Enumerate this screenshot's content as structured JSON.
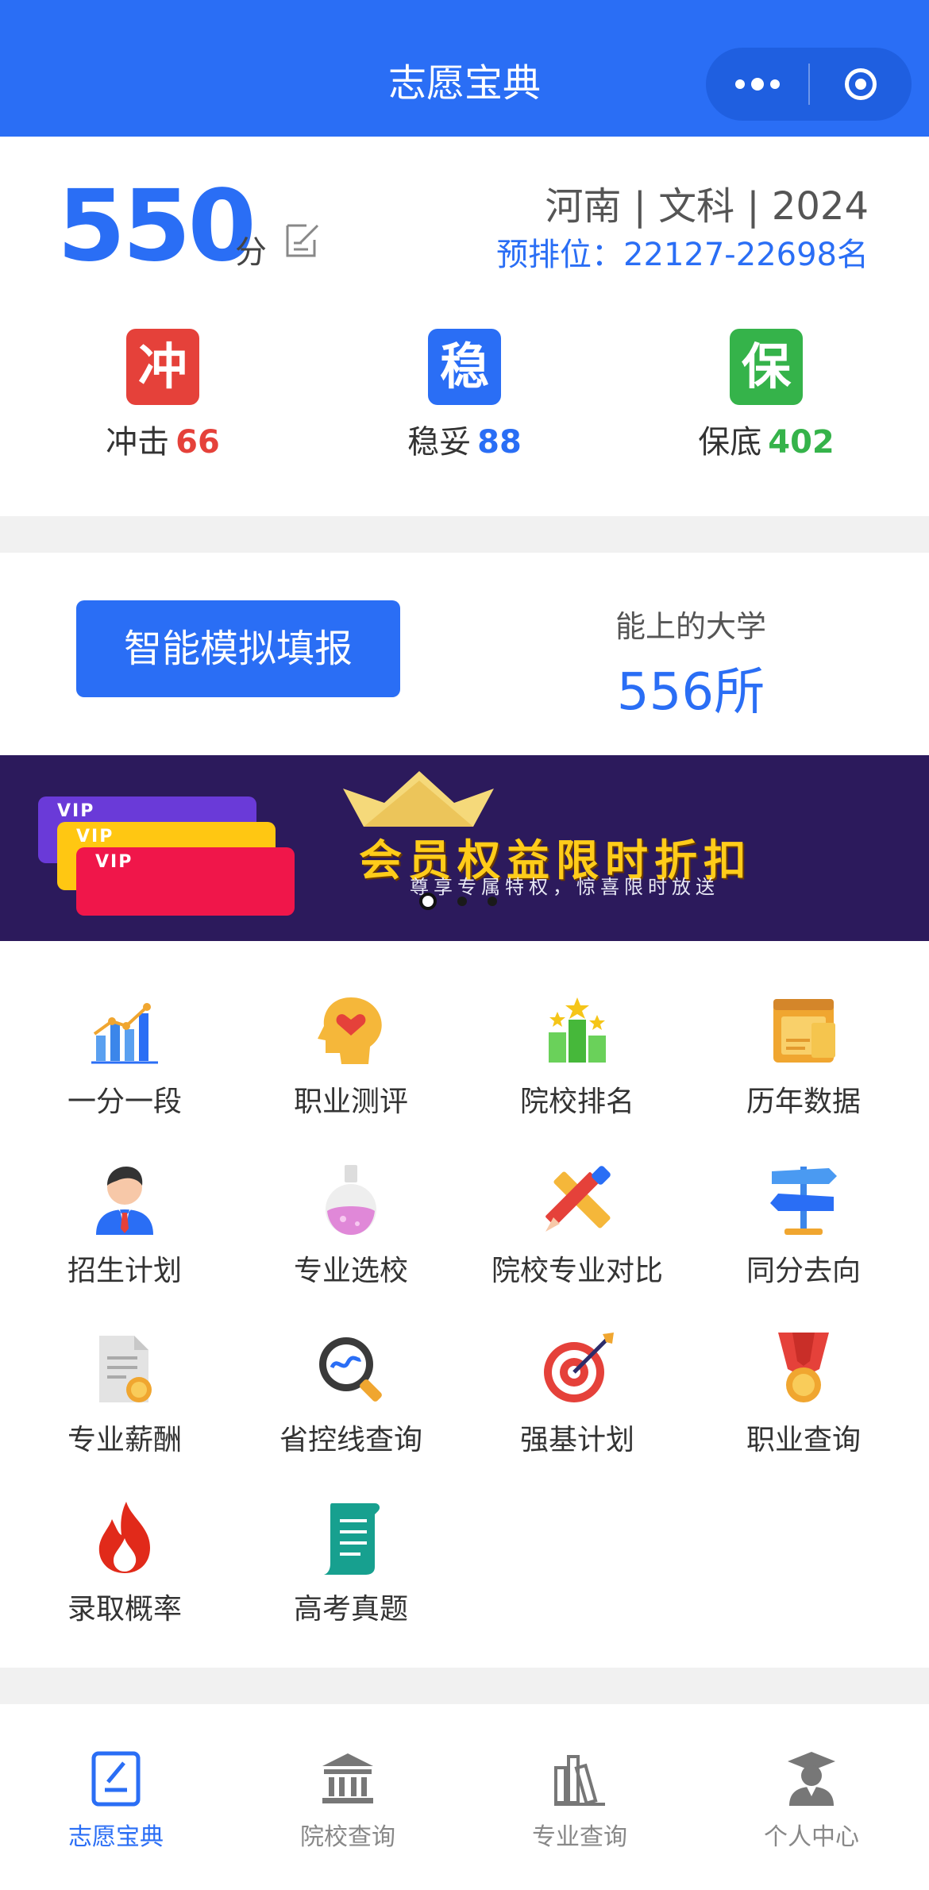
{
  "header": {
    "title": "志愿宝典"
  },
  "score": {
    "value": "550",
    "unit": "分",
    "region_line": "河南 | 文科 | 2024",
    "rank_line": "预排位：22127-22698名"
  },
  "categories": [
    {
      "badge": "冲",
      "label": "冲击",
      "count": "66",
      "color": "#e5413a"
    },
    {
      "badge": "稳",
      "label": "稳妥",
      "count": "88",
      "color": "#2a6ef5"
    },
    {
      "badge": "保",
      "label": "保底",
      "count": "402",
      "color": "#35b34a"
    }
  ],
  "simulate": {
    "button_label": "智能模拟填报",
    "uni_label": "能上的大学",
    "uni_count": "556所"
  },
  "banner": {
    "cards": [
      "VIP",
      "VIP",
      "VIP"
    ],
    "title": "会员权益限时折扣",
    "subtitle": "尊享专属特权，惊喜限时放送",
    "active_dot": 1
  },
  "grid": [
    {
      "label": "一分一段",
      "icon": "bar-chart-icon"
    },
    {
      "label": "职业测评",
      "icon": "head-heart-icon"
    },
    {
      "label": "院校排名",
      "icon": "podium-stars-icon"
    },
    {
      "label": "历年数据",
      "icon": "calendar-icon"
    },
    {
      "label": "招生计划",
      "icon": "person-tie-icon"
    },
    {
      "label": "专业选校",
      "icon": "flask-icon"
    },
    {
      "label": "院校专业对比",
      "icon": "pencil-ruler-icon"
    },
    {
      "label": "同分去向",
      "icon": "signpost-icon"
    },
    {
      "label": "专业薪酬",
      "icon": "document-coin-icon"
    },
    {
      "label": "省控线查询",
      "icon": "magnifier-icon"
    },
    {
      "label": "强基计划",
      "icon": "target-icon"
    },
    {
      "label": "职业查询",
      "icon": "medal-icon"
    },
    {
      "label": "录取概率",
      "icon": "flame-icon"
    },
    {
      "label": "高考真题",
      "icon": "scroll-icon"
    }
  ],
  "tabbar": [
    {
      "label": "志愿宝典",
      "icon": "notebook-icon",
      "active": true
    },
    {
      "label": "院校查询",
      "icon": "institution-icon",
      "active": false
    },
    {
      "label": "专业查询",
      "icon": "books-icon",
      "active": false
    },
    {
      "label": "个人中心",
      "icon": "graduate-icon",
      "active": false
    }
  ],
  "colors": {
    "primary": "#2a6ef5",
    "red": "#e5413a",
    "green": "#35b34a",
    "banner_bg": "#2c1a5c"
  }
}
